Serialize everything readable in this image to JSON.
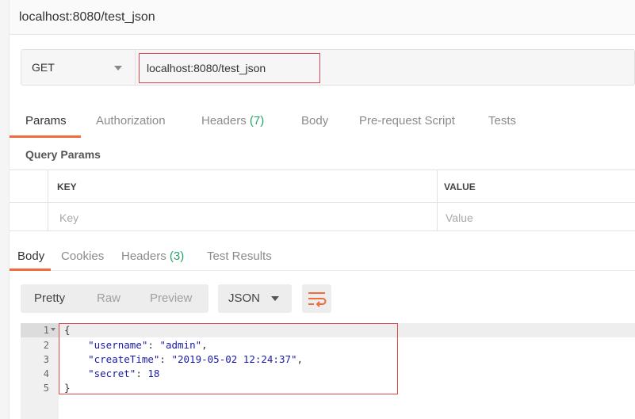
{
  "window": {
    "title": "localhost:8080/test_json"
  },
  "request": {
    "method": "GET",
    "url": "localhost:8080/test_json"
  },
  "request_tabs": [
    {
      "label": "Params",
      "count": ""
    },
    {
      "label": "Authorization",
      "count": ""
    },
    {
      "label": "Headers",
      "count": "(7)"
    },
    {
      "label": "Body",
      "count": ""
    },
    {
      "label": "Pre-request Script",
      "count": ""
    },
    {
      "label": "Tests",
      "count": ""
    }
  ],
  "query_params": {
    "title": "Query Params",
    "col_key": "KEY",
    "col_value": "VALUE",
    "key_placeholder": "Key",
    "value_placeholder": "Value"
  },
  "response_tabs": [
    {
      "label": "Body",
      "count": ""
    },
    {
      "label": "Cookies",
      "count": ""
    },
    {
      "label": "Headers",
      "count": "(3)"
    },
    {
      "label": "Test Results",
      "count": ""
    }
  ],
  "view_modes": [
    "Pretty",
    "Raw",
    "Preview"
  ],
  "format": "JSON",
  "editor": {
    "line_numbers": [
      "1",
      "2",
      "3",
      "4",
      "5"
    ],
    "open_brace": "{",
    "close_brace": "}",
    "fields": [
      {
        "key": "\"username\"",
        "value": "\"admin\"",
        "trail": ","
      },
      {
        "key": "\"createTime\"",
        "value": "\"2019-05-02 12:24:37\"",
        "trail": ","
      },
      {
        "key": "\"secret\"",
        "value": "18",
        "trail": ""
      }
    ]
  },
  "colors": {
    "accent": "#f26b3a",
    "highlight": "#e0454b",
    "count": "#26a269",
    "json_token": "#1a1aa6"
  },
  "icons": {
    "method_dropdown": "chevron-down-icon",
    "wrap": "wrap-lines-icon",
    "fold": "fold-arrow-icon"
  }
}
